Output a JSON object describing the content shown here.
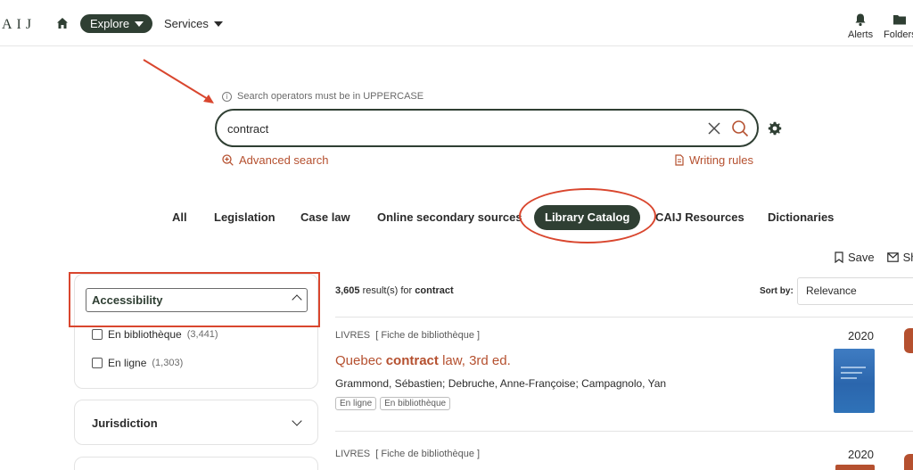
{
  "topbar": {
    "logo": "AIJ",
    "explore_label": "Explore",
    "services_label": "Services",
    "alerts_label": "Alerts",
    "folders_label": "Folders"
  },
  "search": {
    "hint": "Search operators must be in UPPERCASE",
    "query": "contract",
    "advanced_label": "Advanced search",
    "rules_label": "Writing rules"
  },
  "tabs": [
    {
      "label": "All",
      "active": false
    },
    {
      "label": "Legislation",
      "active": false
    },
    {
      "label": "Case law",
      "active": false
    },
    {
      "label": "Online secondary sources",
      "active": false
    },
    {
      "label": "Library Catalog",
      "active": true
    },
    {
      "label": "CAIJ Resources",
      "active": false
    },
    {
      "label": "Dictionaries",
      "active": false
    }
  ],
  "actions": {
    "save_label": "Save",
    "share_label": "Sh"
  },
  "facets": {
    "accessibility": {
      "title": "Accessibility",
      "options": [
        {
          "label": "En bibliothèque",
          "count": "(3,441)"
        },
        {
          "label": "En ligne",
          "count": "(1,303)"
        }
      ]
    },
    "jurisdiction": {
      "title": "Jurisdiction"
    }
  },
  "results": {
    "count": "3,605",
    "count_suffix": "result(s) for",
    "query": "contract",
    "sort_label": "Sort by:",
    "sort_value": "Relevance",
    "items": [
      {
        "type": "LIVRES",
        "subtype": "[ Fiche de bibliothèque ]",
        "year": "2020",
        "title_before": "Quebec ",
        "title_bold": "contract",
        "title_after": " law, 3rd ed.",
        "authors": "Grammond, Sébastien; Debruche, Anne-Françoise; Campagnolo, Yan",
        "badges": [
          "En ligne",
          "En bibliothèque"
        ]
      },
      {
        "type": "LIVRES",
        "subtype": "[ Fiche de bibliothèque ]",
        "year": "2020"
      }
    ]
  },
  "colors": {
    "brand_dark": "#2f3f33",
    "link": "#b5502f",
    "annotation": "#d9462e"
  }
}
